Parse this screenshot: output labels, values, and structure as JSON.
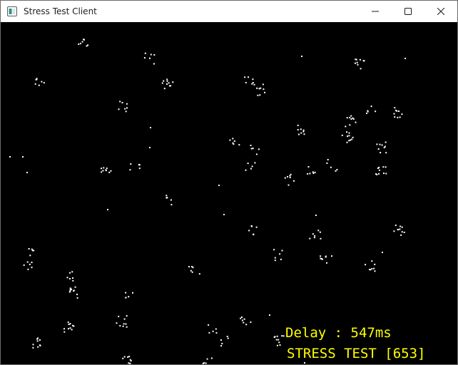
{
  "window": {
    "title": "Stress Test Client",
    "icon": "app-window-icon",
    "buttons": {
      "minimize": "minimize-icon",
      "maximize": "maximize-icon",
      "close": "close-icon"
    }
  },
  "hud": {
    "delay_text": "Delay : 547ms",
    "stress_text": "STRESS TEST [653]"
  },
  "colors": {
    "canvas_bg": "#000000",
    "dots": "#ffffff",
    "hud_text": "#ffff00"
  }
}
